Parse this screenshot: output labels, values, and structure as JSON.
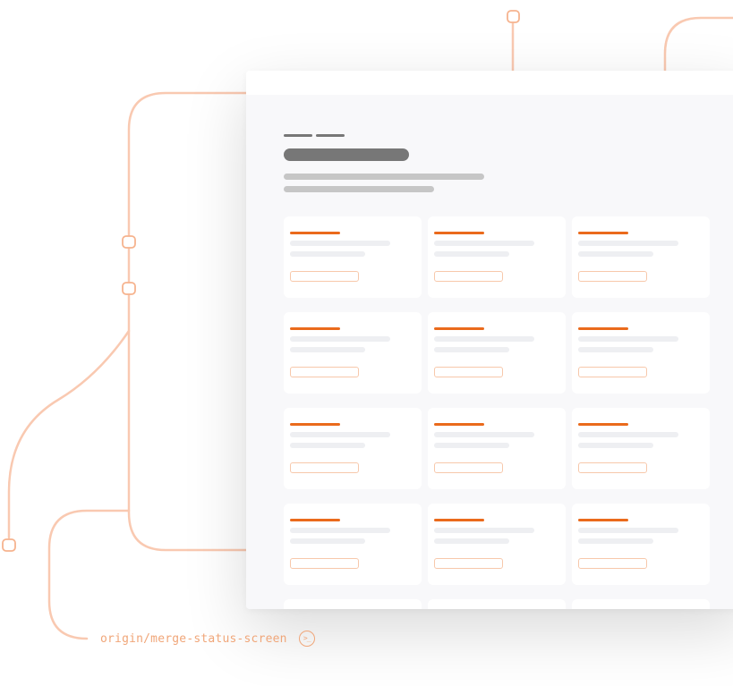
{
  "colors": {
    "line": "#f9c9b1",
    "accent": "#ea6a1c",
    "button_border": "#f7c8ab",
    "label": "#f0a679",
    "skeleton_dark": "#777777",
    "skeleton_mid": "#c6c6c6",
    "skeleton_light": "#eeeff2"
  },
  "page": {
    "header": {
      "crumb_count": 2
    },
    "grid": {
      "columns": 3,
      "rows": 5
    }
  },
  "git_graph": {
    "branch_label": "origin/merge-status-screen",
    "terminal_icon": "terminal-icon",
    "terminal_glyph": ">_"
  }
}
